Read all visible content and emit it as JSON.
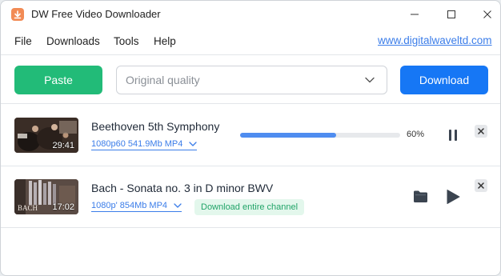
{
  "window": {
    "title": "DW Free Video Downloader"
  },
  "menu": {
    "items": [
      "File",
      "Downloads",
      "Tools",
      "Help"
    ],
    "site_link": "www.digitalwaveltd.com"
  },
  "toolbar": {
    "paste_label": "Paste",
    "quality_value": "Original quality",
    "download_label": "Download"
  },
  "downloads": [
    {
      "title": "Beethoven 5th Symphony",
      "duration": "29:41",
      "meta": "1080p60 541.9Mb MP4",
      "progress_percent": 60,
      "progress_text": "60%",
      "state": "downloading"
    },
    {
      "title": "Bach - Sonata no. 3 in D minor BWV",
      "duration": "17:02",
      "thumb_mark": "BACH",
      "meta": "1080p' 854Mb MP4",
      "channel_label": "Download entire channel",
      "state": "paused"
    }
  ],
  "colors": {
    "accent_green": "#22bb78",
    "accent_blue": "#1677f5",
    "link_blue": "#3b7de9",
    "app_icon": "#f28b55",
    "progress": "#4f8df0"
  },
  "icons": {
    "app": "download-arrow-icon",
    "minimize": "minimize-icon",
    "maximize": "maximize-icon",
    "close": "close-icon",
    "chevron": "chevron-down-icon",
    "pause": "pause-icon",
    "play": "play-icon",
    "folder": "folder-icon",
    "remove": "close-small-icon"
  }
}
